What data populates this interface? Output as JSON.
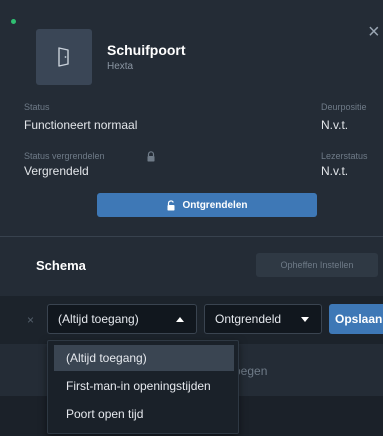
{
  "device": {
    "name": "Schuifpoort",
    "brand": "Hexta"
  },
  "close_icon": "close-icon",
  "info": {
    "status_label": "Status",
    "status_value": "Functioneert normaal",
    "door_position_label": "Deurpositie",
    "door_position_value": "N.v.t.",
    "lock_status_label": "Status vergrendelen",
    "lock_status_value": "Vergrendeld",
    "reader_status_label": "Lezerstatus",
    "reader_status_value": "N.v.t."
  },
  "unlock_button": "Ontgrendelen",
  "schema": {
    "title": "Schema",
    "cancel_set_button": "Opheffen Instellen"
  },
  "rule": {
    "remove_icon": "×",
    "when_select_value": "(Altijd toegang)",
    "state_select_value": "Ontgrendeld",
    "save_button": "Opslaan",
    "partially_hidden_text": "begen"
  },
  "dropdown_options": [
    {
      "label": "(Altijd toegang)",
      "selected": true
    },
    {
      "label": "First-man-in openingstijden",
      "selected": false
    },
    {
      "label": "Poort open tijd",
      "selected": false
    }
  ],
  "colors": {
    "accent": "#3e78b6",
    "background": "#242c36",
    "status_dot": "#2fbf71"
  }
}
